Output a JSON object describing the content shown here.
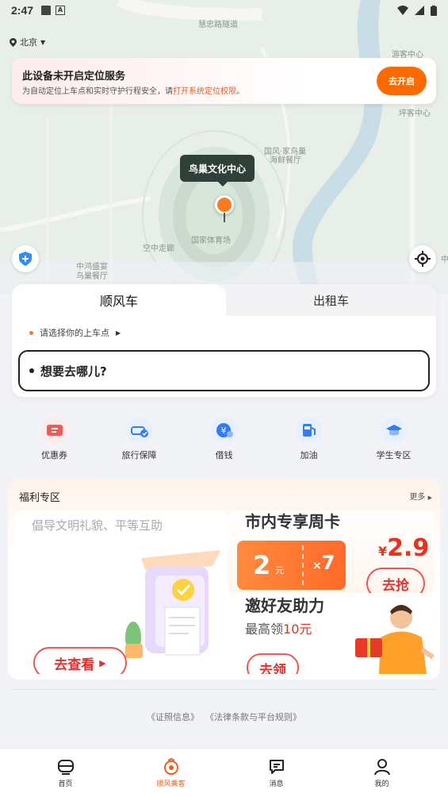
{
  "status_bar": {
    "time": "2:47",
    "notification_letter": "A"
  },
  "map": {
    "city": "北京",
    "labels": [
      "慧忠路隧道",
      "游客中心",
      "国风·家鸟巢",
      "海鲜餐厅",
      "空中走廊",
      "国家体育场",
      "中鸿盛宴",
      "鸟巢餐厅",
      "坪客中心",
      "中"
    ],
    "pin_label": "鸟巢文化中心"
  },
  "location_banner": {
    "title": "此设备未开启定位服务",
    "desc_prefix": "为自动定位上车点和实时守护行程安全，请",
    "desc_link": "打开系统定位权限",
    "desc_suffix": "。",
    "button": "去开启"
  },
  "ride": {
    "tab_active": "顺风车",
    "tab_inactive": "出租车",
    "pickup_prompt": "请选择你的上车点",
    "destination_placeholder": "想要去哪儿?"
  },
  "services": [
    {
      "label": "优惠券",
      "icon": "coupon-icon",
      "color": "#f25a5a"
    },
    {
      "label": "旅行保障",
      "icon": "car-shield-icon",
      "color": "#2f7cf6"
    },
    {
      "label": "借钱",
      "icon": "yuan-icon",
      "color": "#2f7cf6"
    },
    {
      "label": "加油",
      "icon": "fuel-icon",
      "color": "#2f7cf6"
    },
    {
      "label": "学生专区",
      "icon": "graduation-cap-icon",
      "color": "#2f7cf6"
    }
  ],
  "welfare": {
    "title": "福利专区",
    "more": "更多",
    "card_left": {
      "headline": "倡导文明礼貌、平等互助",
      "cta": "去查看"
    },
    "card_weekly": {
      "headline": "市内专享周卡",
      "ticket_value": "2",
      "ticket_unit": "元",
      "ticket_mult_sign": "×",
      "ticket_mult": "7",
      "price_symbol": "¥",
      "price": "2.9",
      "cta": "去抢"
    },
    "card_invite": {
      "headline": "邀好友助力",
      "sub_prefix": "最高领",
      "sub_highlight": "10元",
      "cta": "去领"
    }
  },
  "legal": {
    "license": "《证照信息》",
    "terms": "《法律条款与平台规则》"
  },
  "bottom_nav": [
    {
      "label": "首页",
      "icon": "home-car-icon",
      "active": false
    },
    {
      "label": "顺风乘客",
      "icon": "passenger-icon",
      "active": true
    },
    {
      "label": "消息",
      "icon": "message-icon",
      "active": false
    },
    {
      "label": "我的",
      "icon": "profile-icon",
      "active": false
    }
  ],
  "colors": {
    "accent": "#ff6a00",
    "promo_red": "#e8321e"
  }
}
